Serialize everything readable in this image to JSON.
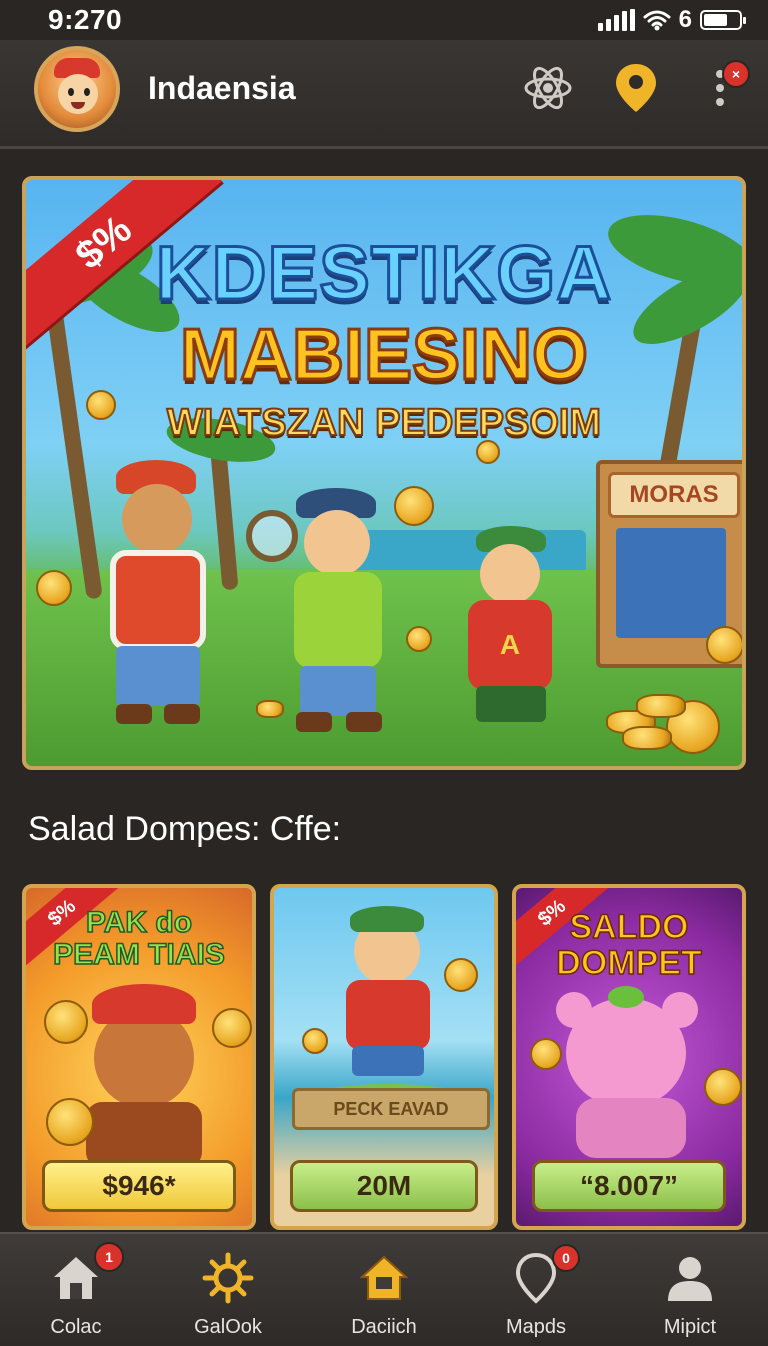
{
  "status_bar": {
    "time": "9:270",
    "battery_text": "6"
  },
  "header": {
    "app_name": "Indaensia",
    "menu_badge": "×"
  },
  "banner": {
    "ribbon_text": "$%",
    "title_line1": "KDESTIKGA",
    "title_line2": "MABIESINO",
    "subtitle": "WIATSZAN PEDEPSOIM",
    "shop_sign": "MORAS",
    "shirt_letter": "A"
  },
  "section_title": "Salad Dompes: Cffe:",
  "cards": [
    {
      "ribbon": "$%",
      "title_line1": "PAK do",
      "title_line2": "PEAM TIAIS",
      "price": "$946*",
      "button_color": "#f4d65a"
    },
    {
      "ribbon": "",
      "title_line1": "",
      "title_line2": "",
      "banner_text": "PECK EAVAD",
      "price": "20M",
      "button_color": "#a8d86a"
    },
    {
      "ribbon": "$%",
      "title_line1": "SALDO",
      "title_line2": "DOMPET",
      "price": "“8.007”",
      "button_color": "#a8d86a"
    }
  ],
  "tabs": [
    {
      "label": "Colac",
      "icon": "home-icon",
      "badge": "1"
    },
    {
      "label": "GalOok",
      "icon": "gear-icon",
      "badge": ""
    },
    {
      "label": "Daciich",
      "icon": "house-active-icon",
      "badge": ""
    },
    {
      "label": "Mapds",
      "icon": "map-pin-icon",
      "badge": "0"
    },
    {
      "label": "Mipict",
      "icon": "user-icon",
      "badge": ""
    }
  ],
  "colors": {
    "accent_gold": "#f0b429",
    "badge_red": "#d8322a",
    "background": "#2a2624"
  }
}
